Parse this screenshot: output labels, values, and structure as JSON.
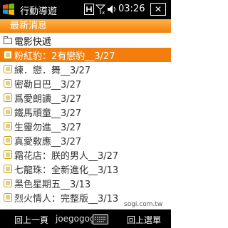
{
  "status_bar": {
    "title": "行動導遊",
    "time": "03:26",
    "close_label": "✕"
  },
  "section_header": "最新消息",
  "list": {
    "heading": "電影快遞",
    "items": [
      "粉紅豹：2有戀豹__3/27",
      "練．戀．舞__3/27",
      "密勒日巴__3/27",
      "爲愛朗讀__3/27",
      "鐵馬頑童__3/27",
      "生靈勿進__3/27",
      "真愛敎應__3/27",
      "霜花店：朕的男人__3/27",
      "七龍珠：全新進化__3/13",
      "黑色星期五__3/13",
      "烈火情人：完整版__3/13"
    ],
    "selected_index": 0
  },
  "softkeys": {
    "left": "回上一頁",
    "user": "joegogogo",
    "right": "回上選單"
  },
  "watermark": "sogi.com.tw",
  "colors": {
    "accent": "#f47e0d",
    "bar": "#000000"
  }
}
